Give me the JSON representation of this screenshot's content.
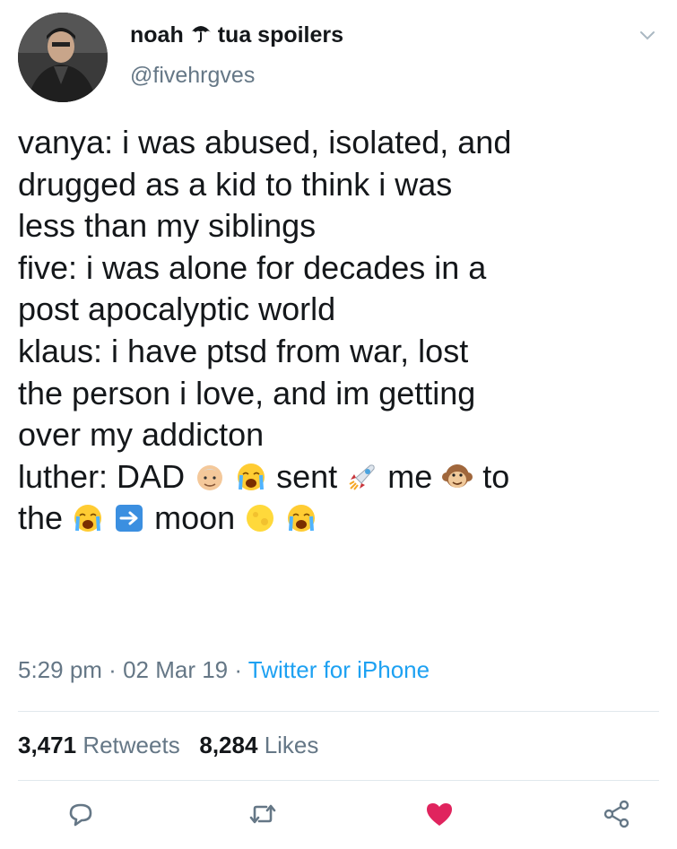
{
  "tweet": {
    "display_name_left": "noah",
    "display_name_right": "tua spoilers",
    "handle": "@fivehrgves",
    "lines": [
      "vanya: i was abused, isolated, and",
      "drugged as a kid to think i was",
      "less than my siblings",
      "five: i was alone for decades in a",
      "post apocalyptic world",
      "klaus: i have ptsd from war, lost",
      "the person i love, and im getting",
      "over my addicton"
    ],
    "luther_line": {
      "part1": "luther: DAD",
      "part2": "sent",
      "part3": " me",
      "part4": " to"
    },
    "last_line": {
      "part1": "the",
      "part2": "moon"
    },
    "time": "5:29 pm",
    "date": "02 Mar 19",
    "source": "Twitter for iPhone",
    "separator": " · "
  },
  "stats": {
    "retweets_count": "3,471",
    "retweets_label": "Retweets",
    "likes_count": "8,284",
    "likes_label": "Likes"
  },
  "icons": {
    "reply": "reply-icon",
    "retweet": "retweet-icon",
    "like": "heart-icon",
    "share": "share-icon",
    "menu": "chevron-down-icon"
  },
  "colors": {
    "text": "#14171a",
    "secondary": "#657786",
    "link": "#1da1f2",
    "like": "#e0245e",
    "divider": "#e1e8ed"
  }
}
